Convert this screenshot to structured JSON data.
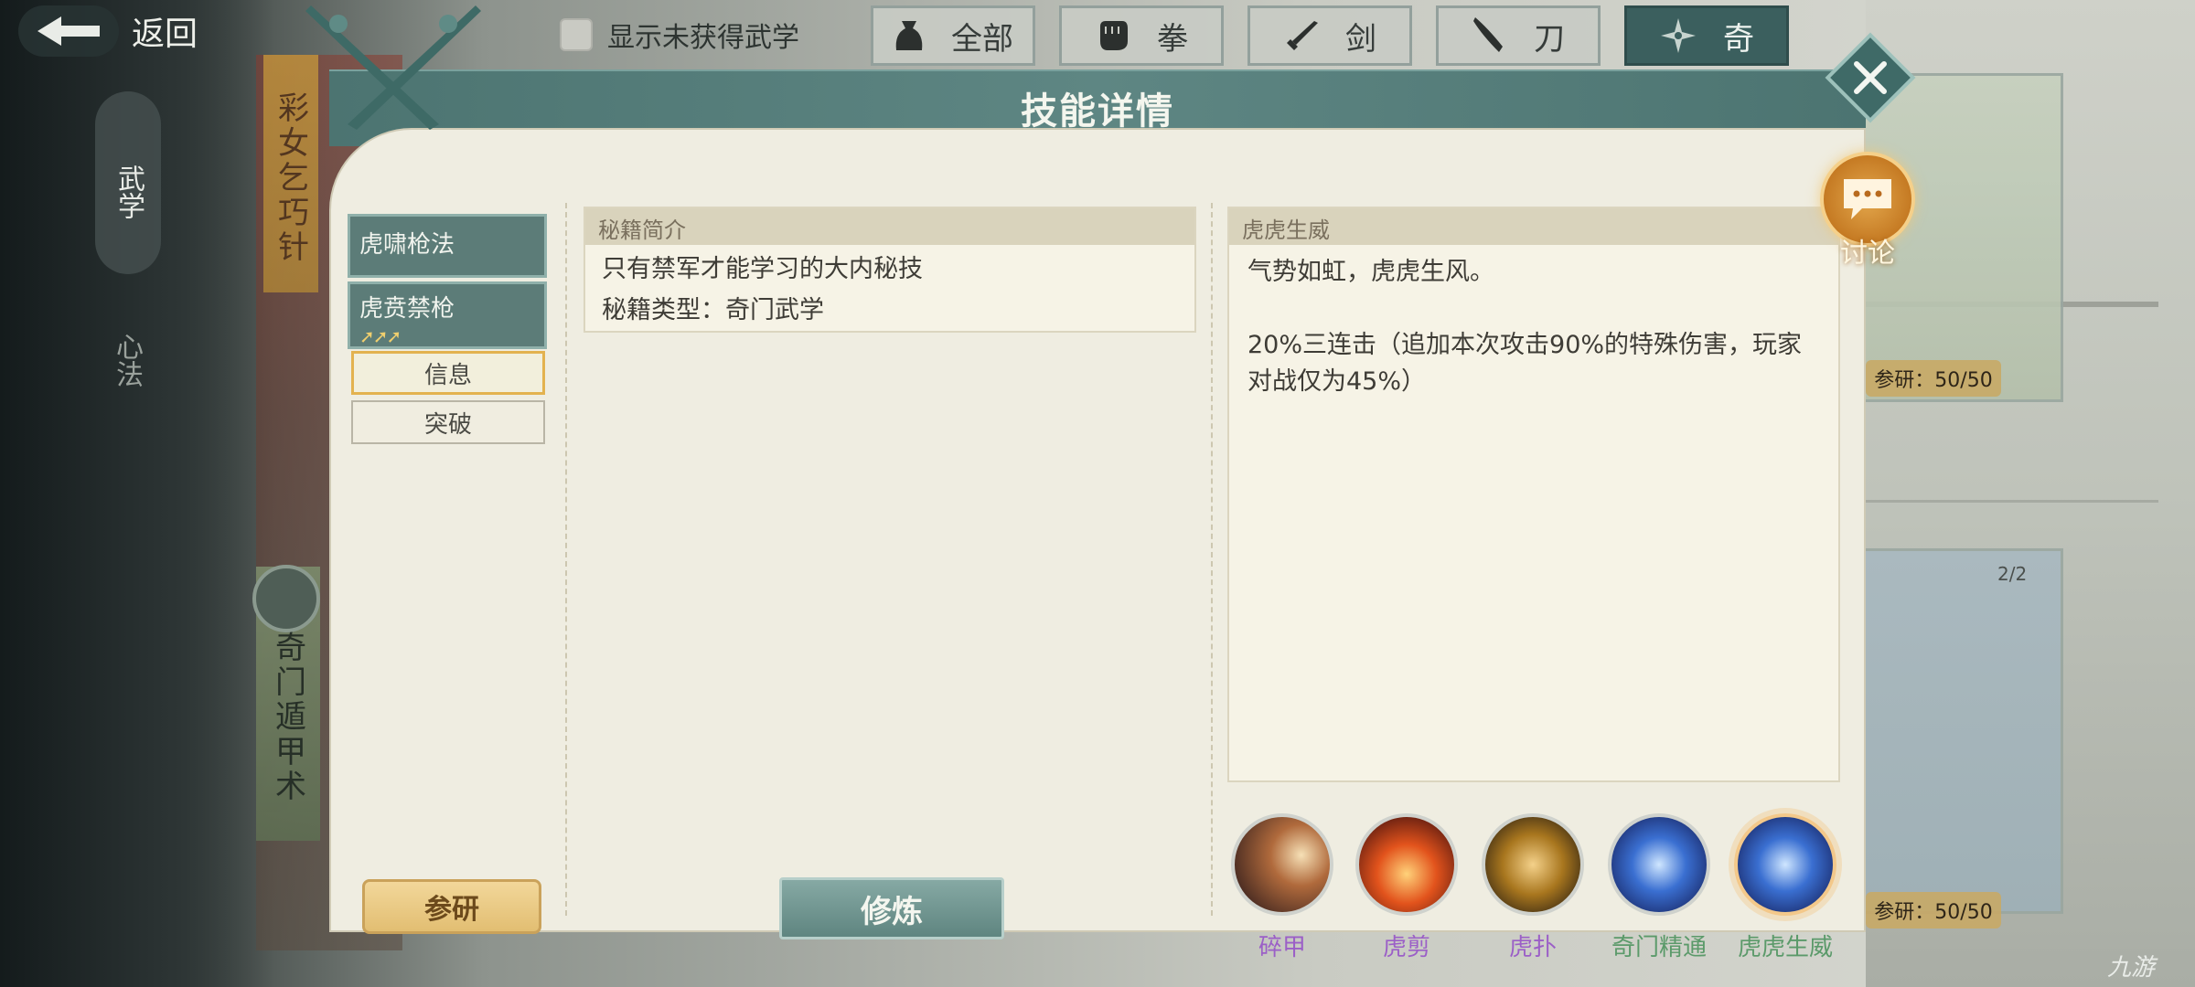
{
  "top": {
    "back_label": "返回",
    "show_unobtained_label": "显示未获得武学",
    "filters": [
      {
        "label": "全部",
        "icon": "bag-icon"
      },
      {
        "label": "拳",
        "icon": "fist-icon"
      },
      {
        "label": "剑",
        "icon": "sword-icon"
      },
      {
        "label": "刀",
        "icon": "blade-icon"
      },
      {
        "label": "奇",
        "icon": "shuriken-icon",
        "active": true
      }
    ]
  },
  "sidebar": {
    "wuxue": "武学",
    "xinfa": "心法"
  },
  "background": {
    "book_top": "彩女乞巧针",
    "book_mid": "奇门遁甲术",
    "canyan_top": "参研：50/50",
    "canyan_bottom": "参研：50/50",
    "book_count": "2/2"
  },
  "modal": {
    "title": "技能详情",
    "discuss_label": "讨论",
    "skills": [
      {
        "name": "虎啸枪法"
      },
      {
        "name": "虎贲禁枪",
        "arrows": "➚➚➚"
      }
    ],
    "subtabs": {
      "info": "信息",
      "tupo": "突破"
    },
    "canyan_button": "参研",
    "mid": {
      "header": "秘籍简介",
      "line1": "只有禁军才能学习的大内秘技",
      "line2": "秘籍类型：奇门武学"
    },
    "xiulian_button": "修炼",
    "detail": {
      "header": "虎虎生威",
      "line1": "气势如虹，虎虎生风。",
      "line2": "20%三连击（追加本次攻击90%的特殊伤害，玩家对战仅为45%）"
    },
    "skill_icons": [
      {
        "name": "碎甲",
        "color": "#9b5fc7"
      },
      {
        "name": "虎剪",
        "color": "#9b5fc7"
      },
      {
        "name": "虎扑",
        "color": "#9b5fc7"
      },
      {
        "name": "奇门精通",
        "color": "#5b9a6a"
      },
      {
        "name": "虎虎生威",
        "color": "#5b9a6a",
        "selected": true
      }
    ]
  },
  "watermark": "九游"
}
